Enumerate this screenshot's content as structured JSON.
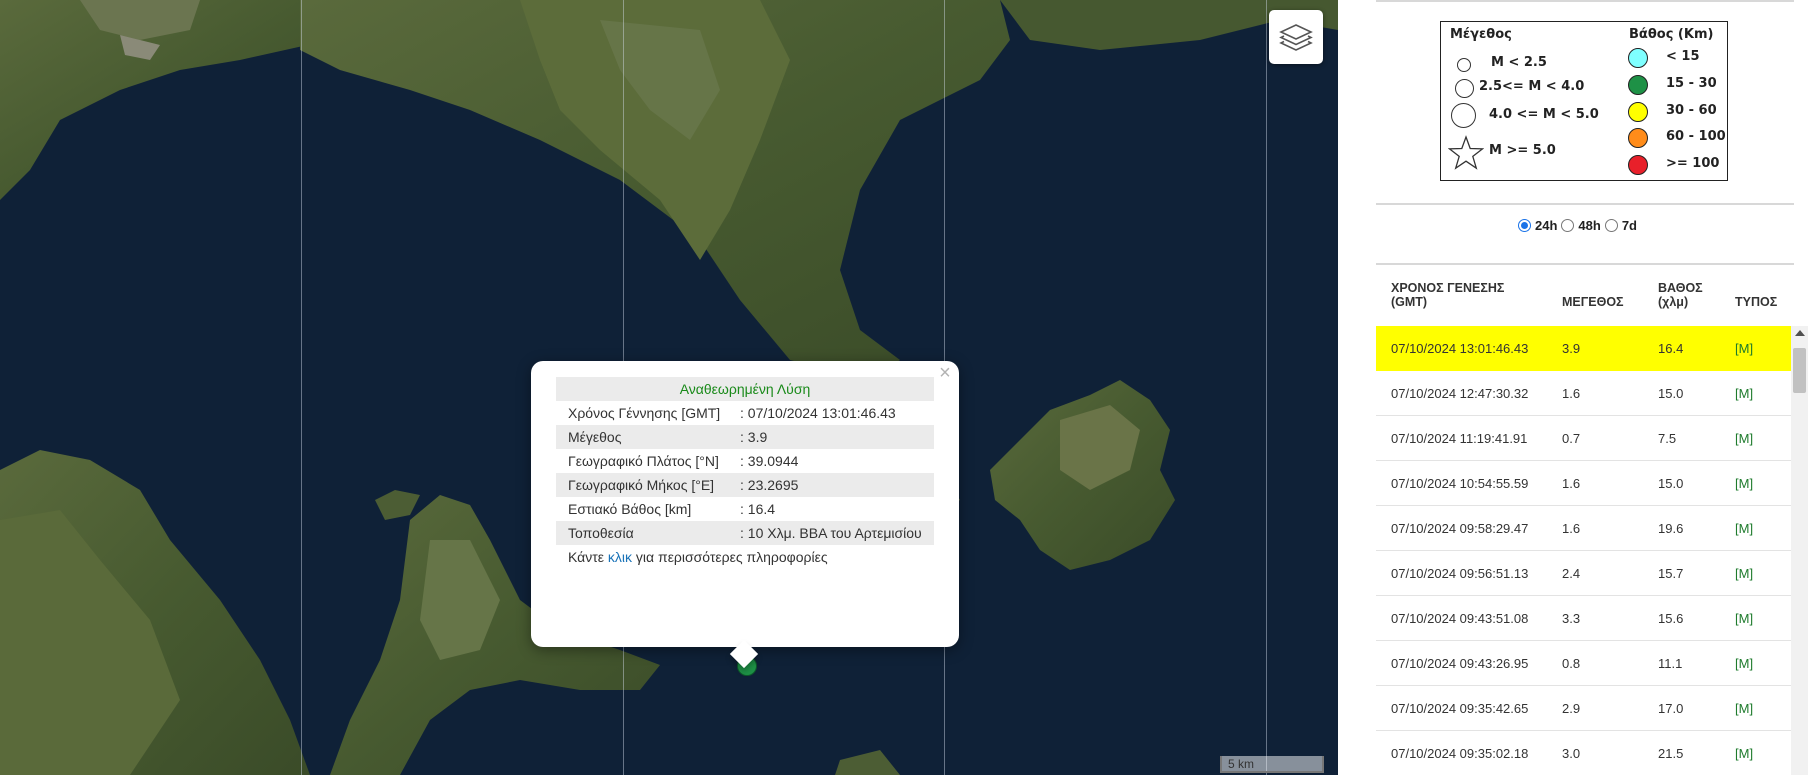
{
  "map": {
    "scale_label": "5 km",
    "layers_icon": "layers-icon",
    "colors": {
      "sea": "#102238",
      "land": "#4a5b32",
      "highland": "#5e6d3e",
      "epicenter": "#1e9146"
    }
  },
  "popup": {
    "title": "Αναθεωρημένη Λύση",
    "close": "×",
    "rows": [
      {
        "label": "Χρόνος Γέννησης [GMT]",
        "value": ": 07/10/2024 13:01:46.43"
      },
      {
        "label": "Μέγεθος",
        "value": ": 3.9"
      },
      {
        "label": "Γεωγραφικό Πλάτος [°N]",
        "value": ": 39.0944"
      },
      {
        "label": "Γεωγραφικό Μήκος [°E]",
        "value": ": 23.2695"
      },
      {
        "label": "Εστιακό Βάθος [km]",
        "value": ": 16.4"
      },
      {
        "label": "Τοποθεσία",
        "value": ": 10 Χλμ. ΒΒΑ του Αρτεμισίου"
      }
    ],
    "more_prefix": "Κάντε ",
    "more_link": "κλικ",
    "more_suffix": " για περισσότερες πληροφορίες"
  },
  "legend": {
    "magnitude_title": "Μέγεθος",
    "depth_title": "Βάθος (Km)",
    "magnitudes": [
      "M < 2.5",
      "2.5<= M < 4.0",
      "4.0 <= M < 5.0",
      "M >= 5.0"
    ],
    "depths": [
      {
        "label": "< 15",
        "color": "#7fffff"
      },
      {
        "label": "15 - 30",
        "color": "#1e9146"
      },
      {
        "label": "30 - 60",
        "color": "#ffff00"
      },
      {
        "label": "60 - 100",
        "color": "#ff8c1a"
      },
      {
        "label": ">= 100",
        "color": "#e8202a"
      }
    ]
  },
  "time_filter": {
    "options": [
      "24h",
      "48h",
      "7d"
    ],
    "selected": "24h"
  },
  "table": {
    "headers": {
      "time_line1": "ΧΡΟΝΟΣ ΓΕΝΕΣΗΣ",
      "time_line2": "(GMT)",
      "magnitude": "ΜΕΓΕΘΟΣ",
      "depth_line1": "ΒΑΘΟΣ",
      "depth_line2": "(χλμ)",
      "type": "ΤΥΠΟΣ"
    },
    "rows": [
      {
        "time": "07/10/2024 13:01:46.43",
        "mag": "3.9",
        "depth": "16.4",
        "type": "[M]"
      },
      {
        "time": "07/10/2024 12:47:30.32",
        "mag": "1.6",
        "depth": "15.0",
        "type": "[M]"
      },
      {
        "time": "07/10/2024 11:19:41.91",
        "mag": "0.7",
        "depth": "7.5",
        "type": "[M]"
      },
      {
        "time": "07/10/2024 10:54:55.59",
        "mag": "1.6",
        "depth": "15.0",
        "type": "[M]"
      },
      {
        "time": "07/10/2024 09:58:29.47",
        "mag": "1.6",
        "depth": "19.6",
        "type": "[M]"
      },
      {
        "time": "07/10/2024 09:56:51.13",
        "mag": "2.4",
        "depth": "15.7",
        "type": "[M]"
      },
      {
        "time": "07/10/2024 09:43:51.08",
        "mag": "3.3",
        "depth": "15.6",
        "type": "[M]"
      },
      {
        "time": "07/10/2024 09:43:26.95",
        "mag": "0.8",
        "depth": "11.1",
        "type": "[M]"
      },
      {
        "time": "07/10/2024 09:35:42.65",
        "mag": "2.9",
        "depth": "17.0",
        "type": "[M]"
      },
      {
        "time": "07/10/2024 09:35:02.18",
        "mag": "3.0",
        "depth": "21.5",
        "type": "[M]"
      }
    ],
    "selected_row_color": "#ffff00"
  }
}
